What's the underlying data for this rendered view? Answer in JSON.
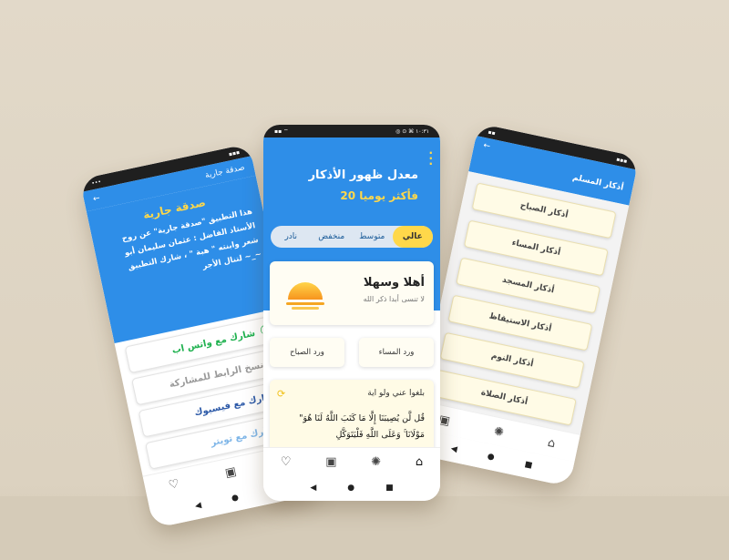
{
  "left_phone": {
    "statusbar": {
      "left": "•••",
      "right": "▪▪▪"
    },
    "header_title": "صدقة جارية",
    "back_icon": "←",
    "card_title": "صدقة جارية",
    "card_body": "هذا التطبيق \"صدقة جارية\" عن روح الأستاذ الفاضل : عثمان سليمان أبو شعر وابنته \" هبة \" ، شارك التطبيق لتنال الأجر ~_~",
    "buttons": [
      {
        "label": "شارك مع واتس اب",
        "icon": "whatsapp-icon",
        "glyph": "✆",
        "color": "#1fb14f"
      },
      {
        "label": "نسخ الرابط للمشاركة",
        "icon": "copy-icon",
        "glyph": "⧉",
        "color": "#9a9a9a"
      },
      {
        "label": "شارك مع فيسبوك",
        "icon": "facebook-icon",
        "glyph": "f",
        "color": "#2d5aa8"
      },
      {
        "label": "شارك مع تويتر",
        "icon": "twitter-icon",
        "glyph": "✦",
        "color": "#7fb6e8"
      }
    ],
    "tabs": [
      "♡",
      "▣",
      "✺"
    ],
    "nav": [
      "◀",
      "●",
      "■"
    ]
  },
  "center_phone": {
    "statusbar": {
      "left": "▪▪ ⌔",
      "right": "◎ ⊙ ⌘ ١٠:٣١"
    },
    "title": "معدل ظهور الأذكار",
    "rate": "20 فأكثر يوميا",
    "segments": [
      "عالي",
      "متوسط",
      "منخفض",
      "نادر"
    ],
    "welcome": {
      "title": "أهلا وسهلا",
      "subtitle": "لا تنسى أبدا ذكر الله"
    },
    "wird": {
      "evening": "ورد المساء",
      "morning": "ورد الصباح"
    },
    "quote": {
      "title": "بلغوا عني ولو اية",
      "text": "\"قُل لَّن يُصِيبَنَا إِلَّا مَا كَتَبَ اللَّهُ لَنَا هُوَ مَوْلَانَا ۚ وَعَلَى اللَّهِ فَلْيَتَوَكَّلِ"
    },
    "tabs": [
      "♡",
      "▣",
      "✺",
      "⌂"
    ],
    "nav": [
      "◀",
      "●",
      "■"
    ]
  },
  "right_phone": {
    "statusbar": {
      "left": "▪▪",
      "right": "▪▪▪"
    },
    "back_icon": "←",
    "title": "أذكار المسلم",
    "items": [
      "أذكار الصباح",
      "أذكار المساء",
      "أذكار المسجد",
      "أذكار الاستيقاظ",
      "أذكار النوم",
      "أذكار الصلاة"
    ],
    "tabs": [
      "▣",
      "✺",
      "⌂"
    ],
    "nav": [
      "◀",
      "●",
      "■"
    ]
  }
}
